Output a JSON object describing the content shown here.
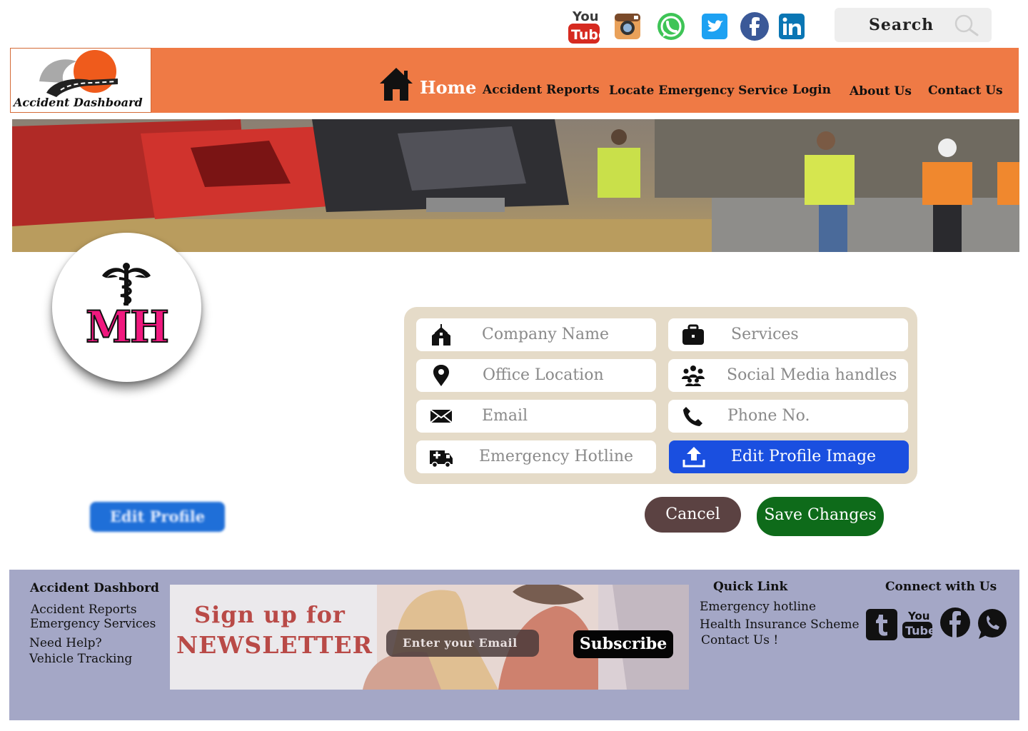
{
  "top_bar": {
    "social_icons": [
      "youtube-icon",
      "instagram-icon",
      "whatsapp-icon",
      "twitter-icon",
      "facebook-icon",
      "linkedin-icon"
    ],
    "search_label": "Search"
  },
  "header": {
    "logo_text": "Accident Dashboard",
    "nav": {
      "home": "Home",
      "accident_reports": "Accident Reports",
      "locate_emergency": "Locate Emergency Service",
      "login": "Login",
      "about": "About Us",
      "contact": "Contact Us"
    },
    "colors": {
      "bar": "#ef7a45"
    }
  },
  "profile": {
    "avatar_text": "MH",
    "edit_profile_label": "Edit Profile"
  },
  "form": {
    "company_name": "Company Name",
    "services": "Services",
    "office_location": "Office Location",
    "social_media": "Social Media handles",
    "email": "Email",
    "phone": "Phone No.",
    "emergency_hotline": "Emergency Hotline",
    "edit_profile_image": "Edit Profile Image"
  },
  "actions": {
    "cancel": "Cancel",
    "save": "Save Changes",
    "colors": {
      "cancel": "#5b4242",
      "save": "#0e6b1a",
      "upload": "#1a4fe0"
    }
  },
  "footer": {
    "col1_title": "Accident Dashbord",
    "col1_links": [
      "Accident Reports",
      "Emergency Services",
      "Need Help?",
      "Vehicle Tracking"
    ],
    "newsletter_line1": "Sign up for",
    "newsletter_line2": "NEWSLETTER",
    "email_placeholder": "Enter your Email",
    "subscribe": "Subscribe",
    "quick_title": "Quick Link",
    "quick_links": [
      "Emergency hotline",
      "Health Insurance Scheme",
      "Contact Us !"
    ],
    "connect_title": "Connect with Us",
    "connect_icons": [
      "tumblr-icon",
      "youtube-icon",
      "facebook-icon",
      "whatsapp-icon"
    ],
    "colors": {
      "background": "#a4a7c6"
    }
  }
}
